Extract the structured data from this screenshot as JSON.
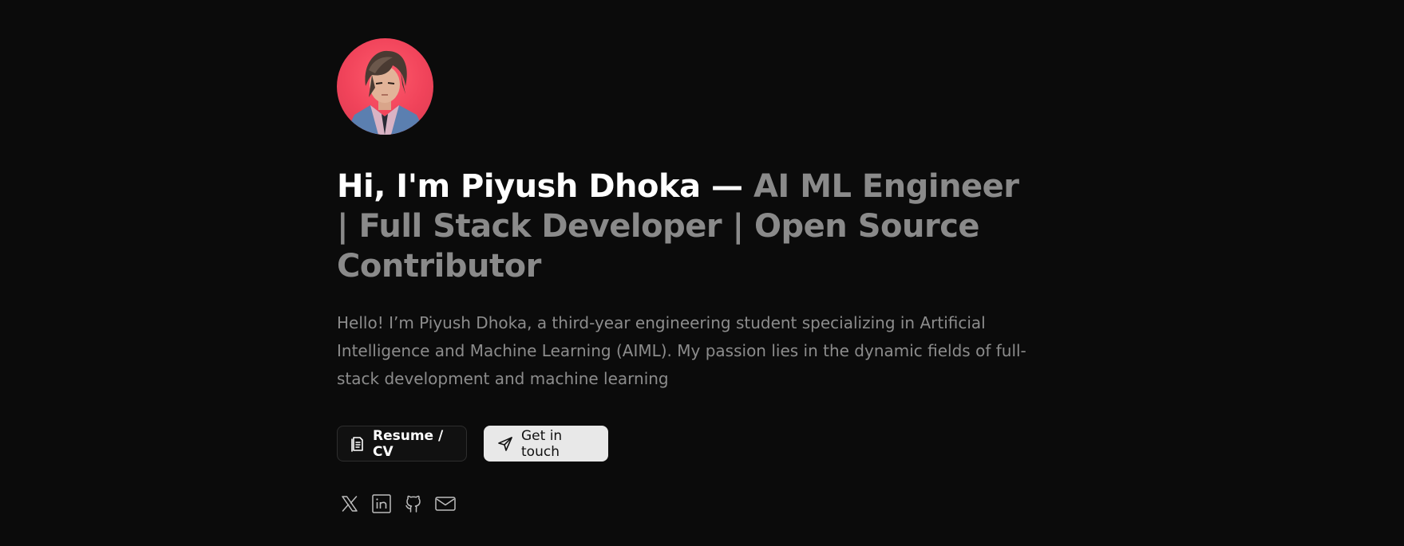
{
  "profile": {
    "avatar_alt": "Piyush Dhoka avatar"
  },
  "headline": {
    "greeting": "Hi, I'm Piyush Dhoka — ",
    "roles": "AI ML Engineer | Full Stack Developer | Open Source Contributor"
  },
  "bio": {
    "text": "Hello! I’m Piyush Dhoka, a third-year engineering student specializing in Artificial Intelligence and Machine Learning (AIML). My passion lies in the dynamic fields of full-stack development and machine learning"
  },
  "actions": {
    "resume_label": "Resume / CV",
    "resume_icon": "document-icon",
    "contact_label": "Get in touch",
    "contact_icon": "send-icon"
  },
  "socials": [
    {
      "name": "x-twitter",
      "icon": "x-icon"
    },
    {
      "name": "linkedin",
      "icon": "linkedin-icon"
    },
    {
      "name": "github",
      "icon": "github-icon"
    },
    {
      "name": "email",
      "icon": "mail-icon"
    }
  ],
  "colors": {
    "background": "#0b0b0b",
    "headline_strong": "#ffffff",
    "headline_muted": "#8a8a8a",
    "bio_text": "#8c8c8c",
    "avatar_bg": "#f0435a",
    "primary_button_bg": "#e8e8e8"
  }
}
